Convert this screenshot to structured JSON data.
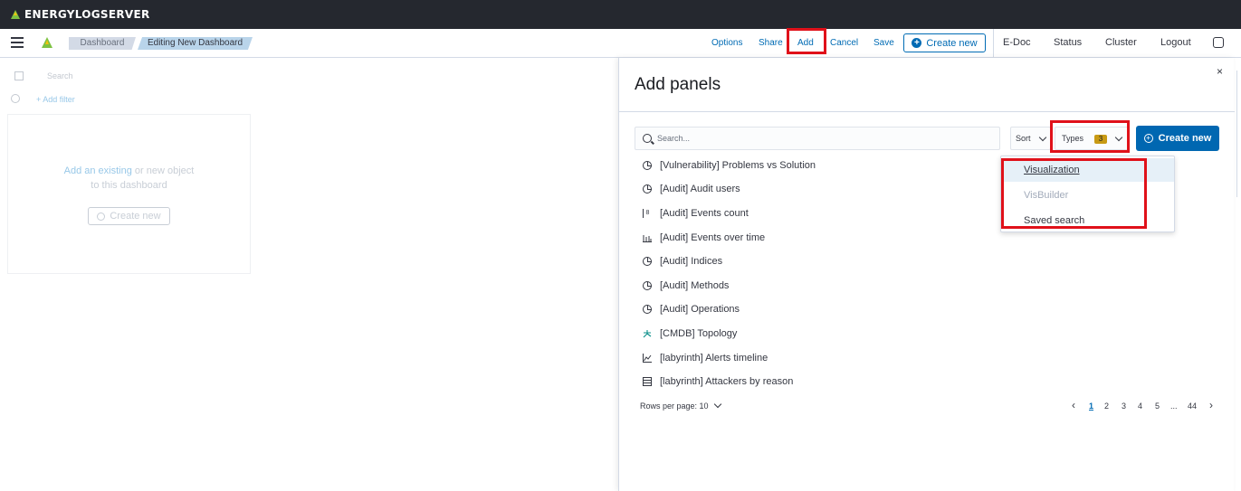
{
  "brand": {
    "name": "ENERGYLOGSERVER"
  },
  "header": {
    "breadcrumbs": [
      "Dashboard",
      "Editing New Dashboard"
    ],
    "actions": [
      "Options",
      "Share",
      "Add",
      "Cancel",
      "Save"
    ],
    "create_new": "Create new",
    "links": [
      "E-Doc",
      "Status",
      "Cluster",
      "Logout"
    ]
  },
  "dashboard_bg": {
    "search_placeholder": "Search",
    "add_filter": "+ Add filter",
    "empty_link": "Add an existing",
    "empty_rest": " or new object",
    "empty_line2": "to this dashboard",
    "create_new": "Create new"
  },
  "flyout": {
    "title": "Add panels",
    "close": "×",
    "search_placeholder": "Search...",
    "sort_label": "Sort",
    "types_label": "Types",
    "types_count": "3",
    "create_new": "Create new",
    "items": [
      {
        "label": "[Vulnerability] Problems vs Solution",
        "icon": "pie-chart-icon"
      },
      {
        "label": "[Audit] Audit users",
        "icon": "pie-chart-icon"
      },
      {
        "label": "[Audit] Events count",
        "icon": "metric-icon"
      },
      {
        "label": "[Audit] Events over time",
        "icon": "bar-chart-icon"
      },
      {
        "label": "[Audit] Indices",
        "icon": "pie-chart-icon"
      },
      {
        "label": "[Audit] Methods",
        "icon": "pie-chart-icon"
      },
      {
        "label": "[Audit] Operations",
        "icon": "pie-chart-icon"
      },
      {
        "label": "[CMDB] Topology",
        "icon": "topology-icon"
      },
      {
        "label": "[labyrinth] Alerts timeline",
        "icon": "line-chart-icon"
      },
      {
        "label": "[labyrinth] Attackers by reason",
        "icon": "table-icon"
      }
    ],
    "rows_per_page": "Rows per page: 10",
    "pages": [
      "1",
      "2",
      "3",
      "4",
      "5",
      "...",
      "44"
    ]
  },
  "types_dropdown": {
    "options": [
      "Visualization",
      "VisBuilder",
      "Saved search"
    ]
  },
  "colors": {
    "brandbar": "#25282f",
    "link": "#006bb4",
    "primary_button": "#0067b1",
    "highlight_box": "#e0111a",
    "badge": "#c89a14"
  }
}
